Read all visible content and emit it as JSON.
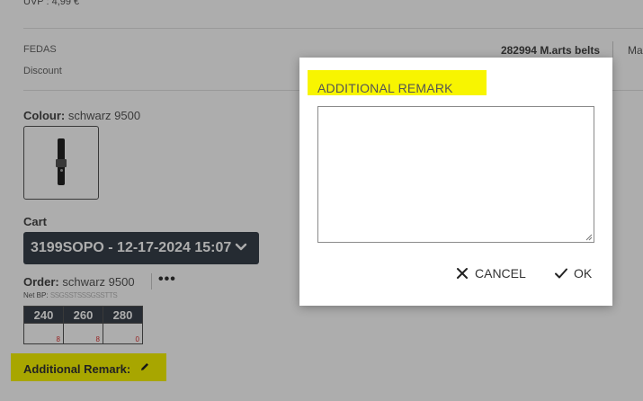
{
  "header": {
    "uvp_label": "UVP : 4,99 €"
  },
  "fedas": {
    "label": "FEDAS",
    "value": "282994 M.arts belts",
    "manufacturer_cut": "Ma"
  },
  "discount": {
    "label": "Discount"
  },
  "colour": {
    "label": "Colour:",
    "value": "schwarz 9500"
  },
  "cart": {
    "label": "Cart",
    "value": "3199SOPO - 12-17-2024 15:07"
  },
  "order": {
    "label": "Order:",
    "value": "schwarz 9500",
    "more": "•••",
    "net_bp_label": "Net BP:",
    "net_bp_obscured": "SSGSSTSSSGSSTTS"
  },
  "sizes": {
    "headers": [
      "240",
      "260",
      "280"
    ],
    "quantities": [
      "8",
      "8",
      "0"
    ]
  },
  "additional_remark": {
    "label": "Additional Remark:"
  },
  "dialog": {
    "title": "ADDITIONAL REMARK",
    "remark_text": "",
    "cancel_label": "CANCEL",
    "ok_label": "OK"
  },
  "colors": {
    "highlight": "#f8f500",
    "dark_select": "#37404a",
    "qty_red": "#d33333"
  },
  "icons": [
    "chevron-down-icon",
    "pencil-icon",
    "close-icon",
    "check-icon",
    "resize-grip-icon",
    "more-icon"
  ]
}
